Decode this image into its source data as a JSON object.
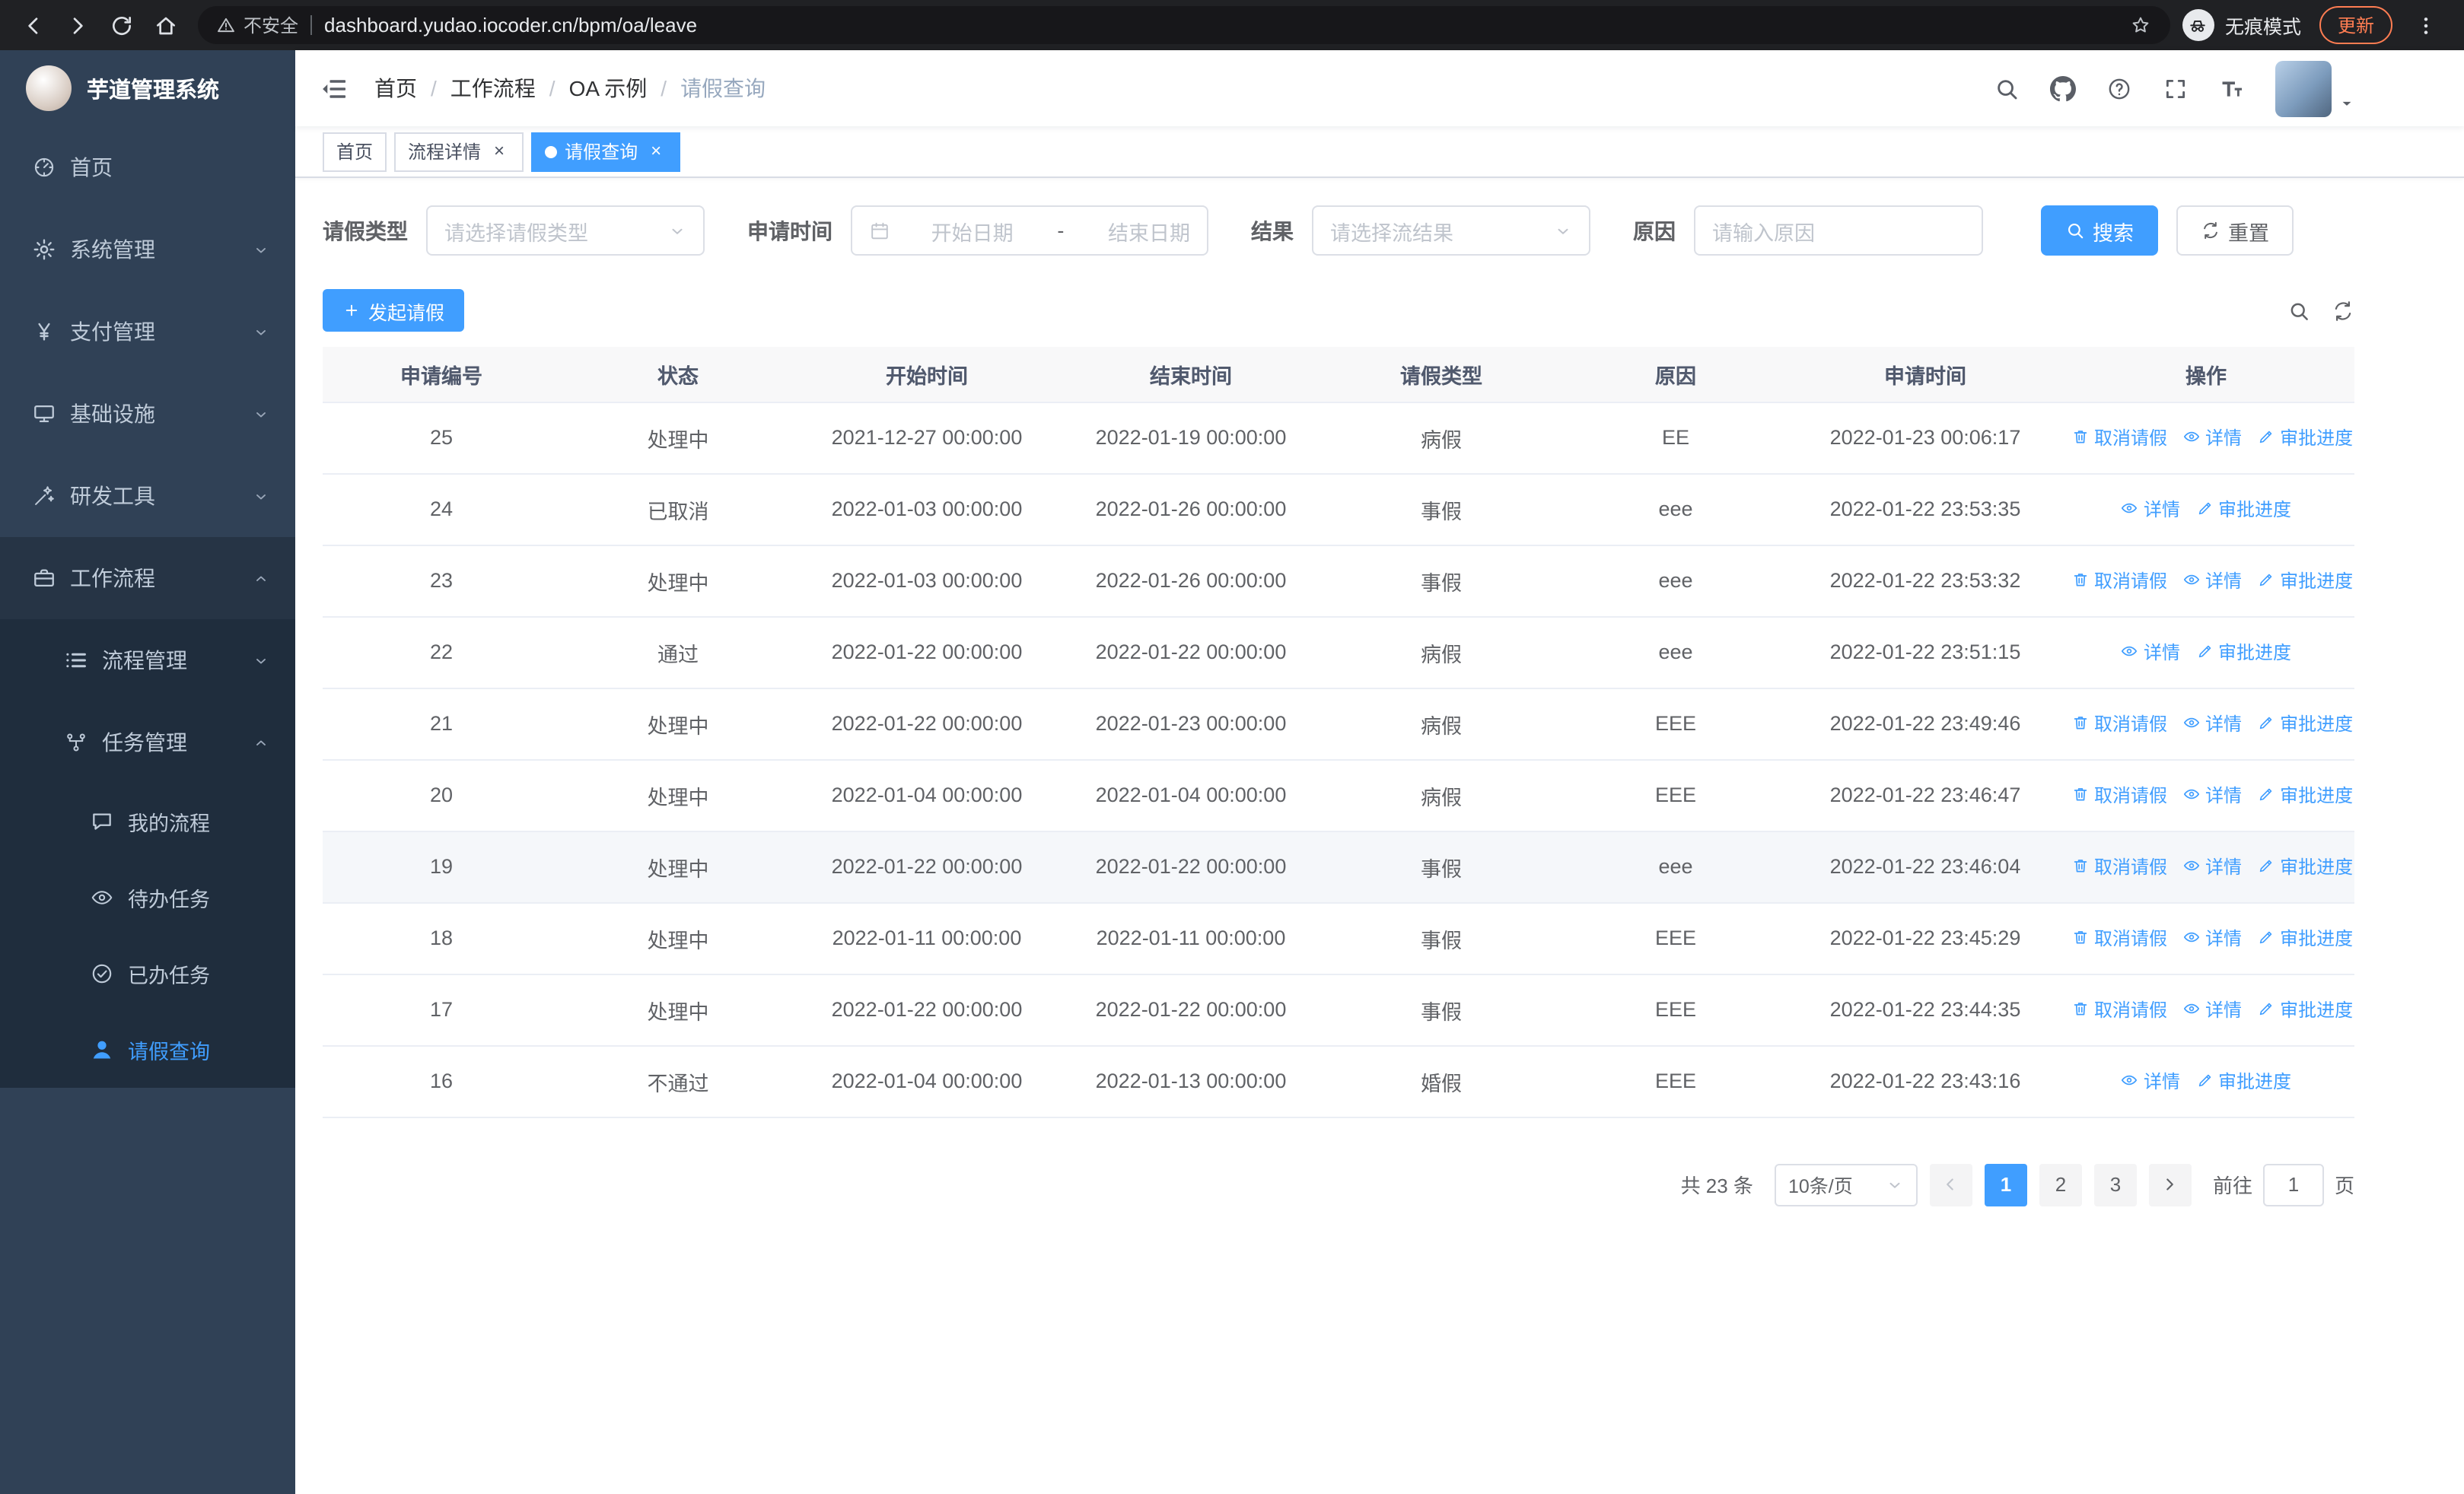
{
  "colors": {
    "accent": "#409eff",
    "sidebar_bg": "#304156",
    "submenu_bg": "#1f2d3d",
    "sidebar_active_parent_bg": "#263445",
    "sidebar_text": "#bfcbd9",
    "chrome_bg": "#202124",
    "omnibox_bg": "#17171a",
    "update_accent": "#ff7d52",
    "table_header_bg": "#f8f8f9",
    "row_border": "#ebeef5",
    "hover_row_bg": "#f5f7fa"
  },
  "browser": {
    "controls": [
      {
        "key": "back-button",
        "icon": "back"
      },
      {
        "key": "forward-button",
        "icon": "forward"
      },
      {
        "key": "reload-button",
        "icon": "reload"
      },
      {
        "key": "home-button",
        "icon": "home"
      }
    ],
    "security_warning": "不安全",
    "url": "dashboard.yudao.iocoder.cn/bpm/oa/leave",
    "incognito_label": "无痕模式",
    "update_button": "更新"
  },
  "sidebar": {
    "logo_title": "芋道管理系统",
    "items": [
      {
        "key": "home",
        "label": "首页",
        "icon": "dashboard",
        "level": 0
      },
      {
        "key": "system-management",
        "label": "系统管理",
        "icon": "gear",
        "level": 0,
        "chevron": "down"
      },
      {
        "key": "payment-management",
        "label": "支付管理",
        "icon": "yen",
        "level": 0,
        "chevron": "down"
      },
      {
        "key": "infrastructure",
        "label": "基础设施",
        "icon": "infra",
        "level": 0,
        "chevron": "down"
      },
      {
        "key": "dev-tools",
        "label": "研发工具",
        "icon": "tools",
        "level": 0,
        "chevron": "down"
      },
      {
        "key": "workflow",
        "label": "工作流程",
        "icon": "workflow",
        "level": 0,
        "chevron": "up",
        "open": true
      },
      {
        "key": "process-management",
        "label": "流程管理",
        "icon": "process",
        "level": 1,
        "chevron": "down",
        "sub": true
      },
      {
        "key": "task-management",
        "label": "任务管理",
        "icon": "task",
        "level": 1,
        "chevron": "up",
        "sub": true
      },
      {
        "key": "my-process",
        "label": "我的流程",
        "icon": "my-process",
        "level": 2,
        "sub": true
      },
      {
        "key": "todo-tasks",
        "label": "待办任务",
        "icon": "todo",
        "level": 2,
        "sub": true
      },
      {
        "key": "done-tasks",
        "label": "已办任务",
        "icon": "done",
        "level": 2,
        "sub": true
      },
      {
        "key": "leave-query",
        "label": "请假查询",
        "icon": "leave-user",
        "level": 2,
        "sub": true,
        "active": true
      }
    ]
  },
  "header": {
    "breadcrumb": [
      {
        "label": "首页"
      },
      {
        "label": "工作流程"
      },
      {
        "label": "OA 示例"
      },
      {
        "label": "请假查询",
        "current": true
      }
    ],
    "tools": [
      {
        "key": "search-button",
        "icon": "search"
      },
      {
        "key": "github-button",
        "icon": "github"
      },
      {
        "key": "help-button",
        "icon": "question"
      },
      {
        "key": "fullscreen-button",
        "icon": "fullscreen"
      },
      {
        "key": "font-size-button",
        "icon": "fontsize"
      }
    ]
  },
  "tabs": [
    {
      "key": "home",
      "label": "首页"
    },
    {
      "key": "process-detail",
      "label": "流程详情",
      "closable": true
    },
    {
      "key": "leave-query",
      "label": "请假查询",
      "closable": true,
      "active": true
    }
  ],
  "filters": {
    "leave_type_label": "请假类型",
    "leave_type_placeholder": "请选择请假类型",
    "apply_time_label": "申请时间",
    "start_date_placeholder": "开始日期",
    "range_separator": "-",
    "end_date_placeholder": "结束日期",
    "result_label": "结果",
    "result_placeholder": "请选择流结果",
    "reason_label": "原因",
    "reason_placeholder": "请输入原因",
    "search_button": "搜索",
    "reset_button": "重置"
  },
  "toolbar": {
    "create_button": "发起请假"
  },
  "table": {
    "columns": [
      "申请编号",
      "状态",
      "开始时间",
      "结束时间",
      "请假类型",
      "原因",
      "申请时间",
      "操作"
    ],
    "action_labels": {
      "cancel": "取消请假",
      "detail": "详情",
      "progress": "审批进度"
    },
    "rows": [
      {
        "id": "25",
        "status": "处理中",
        "start": "2021-12-27 00:00:00",
        "end": "2022-01-19 00:00:00",
        "type": "病假",
        "reason": "EE",
        "applied": "2022-01-23 00:06:17",
        "actions": [
          "cancel",
          "detail",
          "progress"
        ]
      },
      {
        "id": "24",
        "status": "已取消",
        "start": "2022-01-03 00:00:00",
        "end": "2022-01-26 00:00:00",
        "type": "事假",
        "reason": "eee",
        "applied": "2022-01-22 23:53:35",
        "actions": [
          "detail",
          "progress"
        ]
      },
      {
        "id": "23",
        "status": "处理中",
        "start": "2022-01-03 00:00:00",
        "end": "2022-01-26 00:00:00",
        "type": "事假",
        "reason": "eee",
        "applied": "2022-01-22 23:53:32",
        "actions": [
          "cancel",
          "detail",
          "progress"
        ]
      },
      {
        "id": "22",
        "status": "通过",
        "start": "2022-01-22 00:00:00",
        "end": "2022-01-22 00:00:00",
        "type": "病假",
        "reason": "eee",
        "applied": "2022-01-22 23:51:15",
        "actions": [
          "detail",
          "progress"
        ]
      },
      {
        "id": "21",
        "status": "处理中",
        "start": "2022-01-22 00:00:00",
        "end": "2022-01-23 00:00:00",
        "type": "病假",
        "reason": "EEE",
        "applied": "2022-01-22 23:49:46",
        "actions": [
          "cancel",
          "detail",
          "progress"
        ]
      },
      {
        "id": "20",
        "status": "处理中",
        "start": "2022-01-04 00:00:00",
        "end": "2022-01-04 00:00:00",
        "type": "病假",
        "reason": "EEE",
        "applied": "2022-01-22 23:46:47",
        "actions": [
          "cancel",
          "detail",
          "progress"
        ]
      },
      {
        "id": "19",
        "status": "处理中",
        "start": "2022-01-22 00:00:00",
        "end": "2022-01-22 00:00:00",
        "type": "事假",
        "reason": "eee",
        "applied": "2022-01-22 23:46:04",
        "actions": [
          "cancel",
          "detail",
          "progress"
        ],
        "hover": true
      },
      {
        "id": "18",
        "status": "处理中",
        "start": "2022-01-11 00:00:00",
        "end": "2022-01-11 00:00:00",
        "type": "事假",
        "reason": "EEE",
        "applied": "2022-01-22 23:45:29",
        "actions": [
          "cancel",
          "detail",
          "progress"
        ]
      },
      {
        "id": "17",
        "status": "处理中",
        "start": "2022-01-22 00:00:00",
        "end": "2022-01-22 00:00:00",
        "type": "事假",
        "reason": "EEE",
        "applied": "2022-01-22 23:44:35",
        "actions": [
          "cancel",
          "detail",
          "progress"
        ]
      },
      {
        "id": "16",
        "status": "不通过",
        "start": "2022-01-04 00:00:00",
        "end": "2022-01-13 00:00:00",
        "type": "婚假",
        "reason": "EEE",
        "applied": "2022-01-22 23:43:16",
        "actions": [
          "detail",
          "progress"
        ]
      }
    ]
  },
  "pagination": {
    "total_text": "共 23 条",
    "page_size": "10条/页",
    "pages": [
      "1",
      "2",
      "3"
    ],
    "active_page": "1",
    "goto_label": "前往",
    "goto_value": "1",
    "goto_suffix": "页"
  }
}
